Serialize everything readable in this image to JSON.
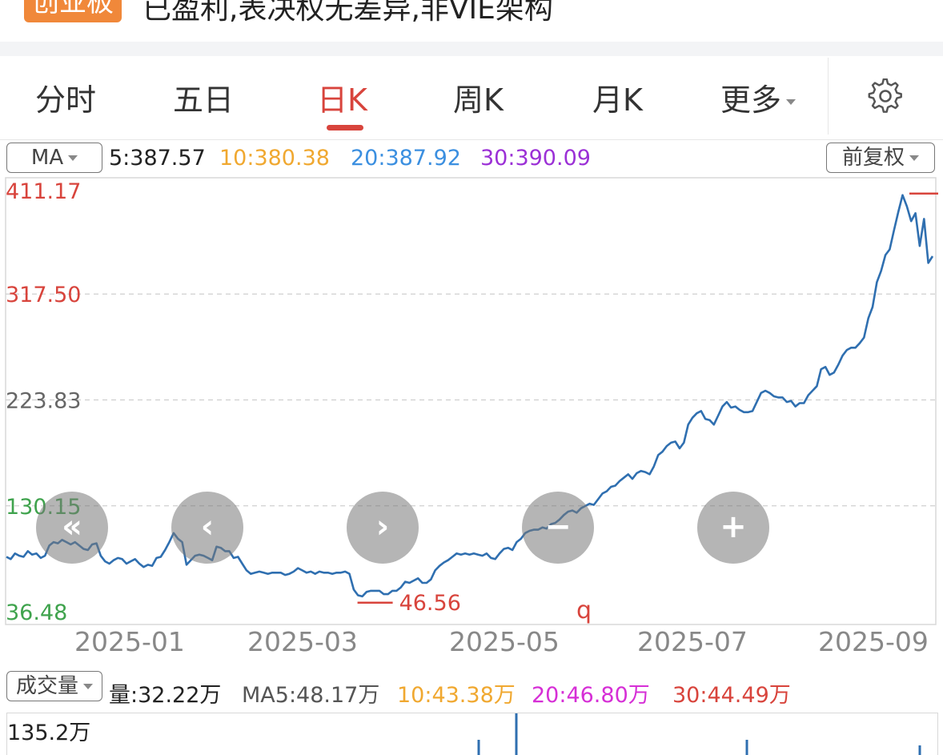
{
  "header": {
    "board_badge": "创业板",
    "description": "已盈利,表决权无差异,非VIE架构"
  },
  "tabs": [
    {
      "label": "分时",
      "active": false
    },
    {
      "label": "五日",
      "active": false
    },
    {
      "label": "日K",
      "active": true
    },
    {
      "label": "周K",
      "active": false
    },
    {
      "label": "月K",
      "active": false
    },
    {
      "label": "更多",
      "active": false
    }
  ],
  "settings_icon": "gear-icon",
  "ma_bar": {
    "selector": "MA",
    "ma5": "5:387.57",
    "ma10": "10:380.38",
    "ma20": "20:387.92",
    "ma30": "30:390.09",
    "adjust": "前复权",
    "colors": {
      "ma5": "#222222",
      "ma10": "#f0a830",
      "ma20": "#3b8fe0",
      "ma30": "#9b30d6"
    }
  },
  "overlay_buttons": [
    {
      "name": "fast-back",
      "icon": "double-chevron-left-icon"
    },
    {
      "name": "prev",
      "icon": "chevron-left-icon"
    },
    {
      "name": "next",
      "icon": "chevron-right-icon"
    },
    {
      "name": "zoom-out",
      "icon": "minus-icon"
    },
    {
      "name": "zoom-in",
      "icon": "plus-icon"
    }
  ],
  "chart_data": {
    "type": "line",
    "y_ticks": [
      "411.17",
      "317.50",
      "223.83",
      "130.15",
      "36.48"
    ],
    "ylim": [
      36.48,
      411.17
    ],
    "x_ticks": [
      "2025-01",
      "2025-03",
      "2025-05",
      "2025-07",
      "2025-09"
    ],
    "max_marker": "",
    "min_marker": "46.56",
    "extra_label": "q",
    "line_color": "#2f6fb0",
    "grid": "dashed horizontal",
    "series": [
      {
        "values": [
          85,
          83,
          88,
          86,
          85,
          90,
          87,
          88,
          84,
          86,
          95,
          98,
          97,
          100,
          98,
          96,
          98,
          95,
          92,
          91,
          96,
          97,
          86,
          81,
          79,
          82,
          84,
          83,
          79,
          81,
          83,
          79,
          76,
          78,
          77,
          84,
          85,
          91,
          98,
          106,
          101,
          98,
          78,
          82,
          86,
          87,
          86,
          84,
          82,
          94,
          93,
          90,
          90,
          84,
          85,
          79,
          73,
          70,
          71,
          72,
          71,
          70,
          71,
          71,
          71,
          69,
          70,
          72,
          75,
          73,
          71,
          72,
          70,
          72,
          71,
          71,
          70,
          71,
          71,
          72,
          70,
          56,
          51,
          50,
          54,
          55,
          55,
          55,
          52,
          52,
          55,
          55,
          58,
          63,
          62,
          64,
          66,
          62,
          62,
          65,
          73,
          77,
          80,
          82,
          85,
          88,
          87,
          88,
          87,
          88,
          87,
          86,
          88,
          84,
          83,
          88,
          92,
          93,
          91,
          98,
          101,
          106,
          108,
          109,
          109,
          111,
          110,
          114,
          115,
          118,
          122,
          125,
          126,
          124,
          128,
          130,
          132,
          131,
          136,
          141,
          143,
          147,
          148,
          152,
          155,
          158,
          154,
          159,
          161,
          160,
          158,
          165,
          175,
          178,
          183,
          186,
          187,
          181,
          186,
          202,
          208,
          212,
          214,
          207,
          206,
          202,
          210,
          218,
          222,
          217,
          218,
          215,
          213,
          213,
          214,
          222,
          230,
          232,
          230,
          227,
          226,
          226,
          222,
          223,
          218,
          221,
          221,
          228,
          232,
          236,
          251,
          253,
          246,
          248,
          255,
          263,
          268,
          270,
          270,
          274,
          279,
          296,
          306,
          328,
          338,
          352,
          357,
          374,
          390,
          405,
          395,
          382,
          389,
          360,
          384,
          345,
          351
        ]
      }
    ]
  },
  "volume_bar": {
    "selector": "成交量",
    "vol": "量:32.22万",
    "ma5": "MA5:48.17万",
    "ma10": "10:43.38万",
    "ma20": "20:46.80万",
    "ma30": "30:44.49万",
    "max_label": "135.2万",
    "colors": {
      "vol": "#222222",
      "ma5": "#555555",
      "ma10": "#f0a830",
      "ma20": "#d62fd6",
      "ma30": "#d8443c"
    }
  }
}
